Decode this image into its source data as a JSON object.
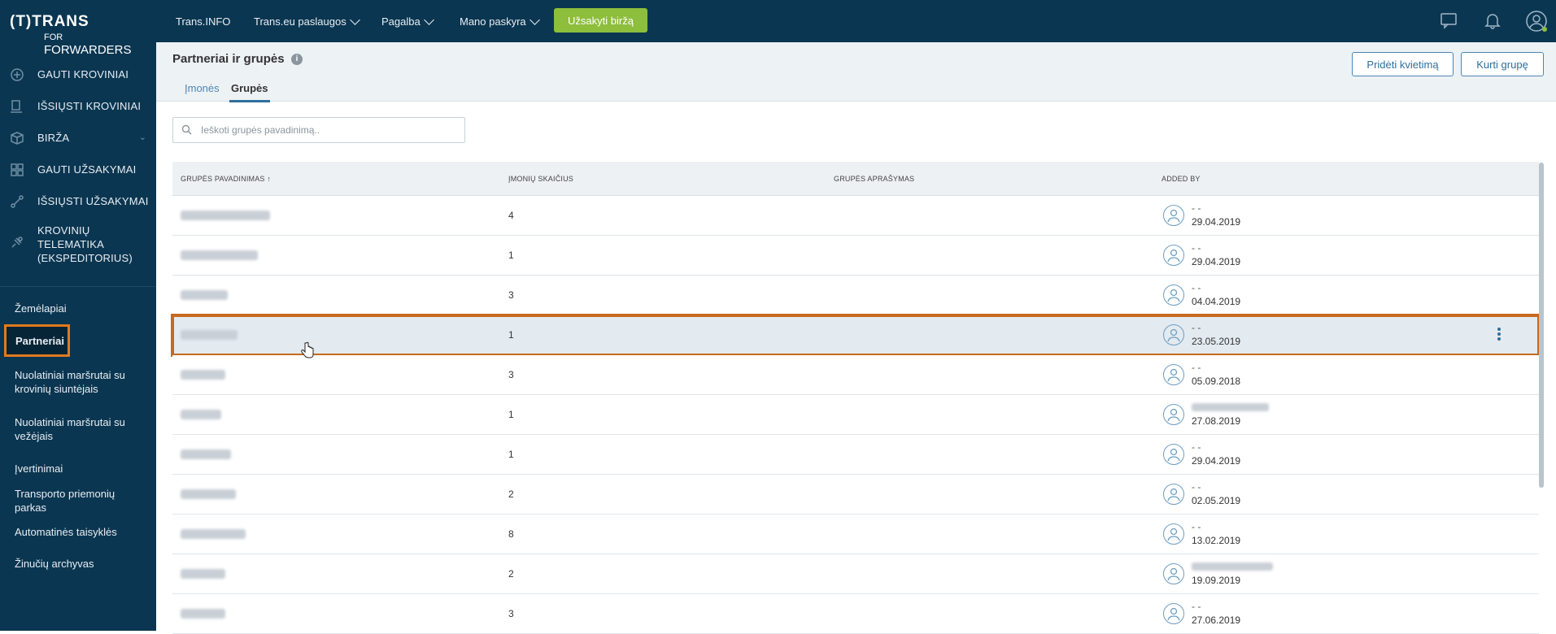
{
  "brand": {
    "logo_top": "(T)TRANS",
    "logo_bottom_prefix": "FOR",
    "logo_bottom": "FORWARDERS"
  },
  "sidebar": {
    "main_items": [
      {
        "label": "GAUTI KROVINIAI",
        "icon": "cargo-in-icon"
      },
      {
        "label": "IŠSIŲSTI KROVINIAI",
        "icon": "cargo-out-icon"
      },
      {
        "label": "BIRŽA",
        "icon": "box-icon"
      },
      {
        "label": "GAUTI UŽSAKYMAI",
        "icon": "grid-icon"
      },
      {
        "label": "IŠSIŲSTI UŽSAKYMAI",
        "icon": "send-orders-icon"
      },
      {
        "label": "KROVINIŲ TELEMATIKA (EKSPEDITORIUS)",
        "icon": "satellite-icon"
      }
    ],
    "sub_items": [
      {
        "label": "Žemėlapiai"
      },
      {
        "label": "Partneriai"
      },
      {
        "label": "Nuolatiniai maršrutai su krovinių siuntėjais"
      },
      {
        "label": "Nuolatiniai maršrutai su vežėjais"
      },
      {
        "label": "Įvertinimai"
      },
      {
        "label": "Transporto priemonių parkas"
      },
      {
        "label": "Automatinės taisyklės"
      },
      {
        "label": "Žinučių archyvas"
      }
    ]
  },
  "topbar": {
    "links": [
      "Trans.INFO",
      "Trans.eu paslaugos",
      "Pagalba",
      "Mano paskyra"
    ],
    "order_button": "Užsakyti biržą"
  },
  "page": {
    "title": "Partneriai ir grupės",
    "tabs": [
      "Įmonės",
      "Grupės"
    ],
    "active_tab": "Grupės",
    "invite_button": "Pridėti kvietimą",
    "create_group_button": "Kurti grupę"
  },
  "search": {
    "placeholder": "Ieškoti grupės pavadinimą.."
  },
  "table": {
    "columns": [
      "GRUPĖS PAVADINIMAS ↑",
      "ĮMONIŲ SKAIČIUS",
      "GRUPĖS APRAŠYMAS",
      "ADDED BY"
    ],
    "rows": [
      {
        "count": "4",
        "added_by": "- -",
        "date": "29.04.2019"
      },
      {
        "count": "1",
        "added_by": "- -",
        "date": "29.04.2019"
      },
      {
        "count": "3",
        "added_by": "- -",
        "date": "04.04.2019"
      },
      {
        "count": "1",
        "added_by": "- -",
        "date": "23.05.2019"
      },
      {
        "count": "3",
        "added_by": "- -",
        "date": "05.09.2018"
      },
      {
        "count": "1",
        "added_by": "",
        "date": "27.08.2019"
      },
      {
        "count": "1",
        "added_by": "- -",
        "date": "29.04.2019"
      },
      {
        "count": "2",
        "added_by": "- -",
        "date": "02.05.2019"
      },
      {
        "count": "8",
        "added_by": "- -",
        "date": "13.02.2019"
      },
      {
        "count": "2",
        "added_by": "",
        "date": "19.09.2019"
      },
      {
        "count": "3",
        "added_by": "- -",
        "date": "27.06.2019"
      }
    ]
  },
  "colors": {
    "sidebar": "#0b3651",
    "accent_orange": "#e07a1f",
    "green_button": "#8dbe3c",
    "link_blue": "#2e6f9c"
  }
}
